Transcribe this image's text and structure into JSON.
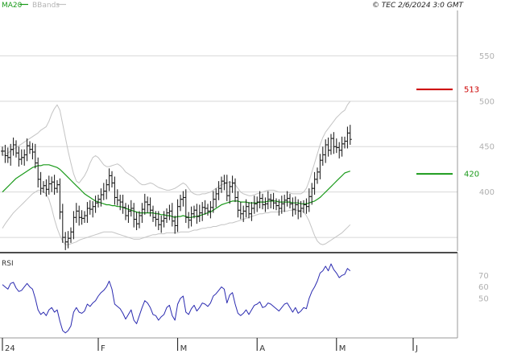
{
  "legend": {
    "ma_label": "MA20",
    "bb_label": "BBands"
  },
  "copyright": "© TEC 2/6/2024 3:0 GMT",
  "colors": {
    "price": "#111111",
    "ma": "#1a9a1a",
    "bbands": "#c4c4c4",
    "resistance": "#cc0000",
    "support": "#1a9a1a",
    "rsi": "#2a2ab0",
    "grid": "#d8d8d8"
  },
  "chart_data": [
    {
      "type": "ohlc",
      "yticks": [
        550,
        500,
        450,
        400
      ],
      "ylim": [
        335,
        600
      ],
      "x_ticks": [
        {
          "label": "24",
          "bar": 0
        },
        {
          "label": "F",
          "bar": 35
        },
        {
          "label": "M",
          "bar": 64
        },
        {
          "label": "A",
          "bar": 93
        },
        {
          "label": "M",
          "bar": 122
        },
        {
          "label": "J",
          "bar": 150
        }
      ],
      "levels": [
        {
          "value": 513,
          "label": "513",
          "kind": "resistance"
        },
        {
          "value": 420,
          "label": "420",
          "kind": "support"
        }
      ],
      "close": [
        445,
        440,
        438,
        447,
        452,
        443,
        436,
        438,
        441,
        451,
        447,
        444,
        432,
        414,
        404,
        407,
        403,
        409,
        411,
        404,
        408,
        378,
        350,
        345,
        349,
        356,
        372,
        379,
        372,
        371,
        374,
        382,
        381,
        384,
        388,
        392,
        397,
        401,
        408,
        418,
        410,
        394,
        391,
        389,
        383,
        374,
        379,
        382,
        370,
        365,
        374,
        381,
        389,
        386,
        380,
        372,
        370,
        364,
        368,
        371,
        377,
        379,
        368,
        363,
        384,
        392,
        394,
        372,
        369,
        376,
        380,
        373,
        377,
        383,
        382,
        379,
        383,
        392,
        398,
        404,
        412,
        410,
        396,
        406,
        410,
        394,
        380,
        376,
        379,
        384,
        376,
        382,
        387,
        389,
        393,
        386,
        387,
        392,
        391,
        388,
        385,
        382,
        387,
        391,
        393,
        387,
        381,
        386,
        379,
        382,
        386,
        384,
        395,
        404,
        414,
        422,
        435,
        441,
        452,
        446,
        459,
        450,
        449,
        446,
        453,
        456,
        465,
        458
      ],
      "ma20": [
        400,
        403,
        406,
        409,
        412,
        415,
        417,
        419,
        421,
        423,
        425,
        427,
        428,
        429,
        429,
        430,
        430,
        430,
        429,
        428,
        427,
        425,
        422,
        419,
        416,
        413,
        410,
        407,
        404,
        401,
        398,
        396,
        394,
        392,
        390,
        389,
        388,
        387,
        386,
        386,
        385,
        385,
        384,
        384,
        383,
        382,
        381,
        380,
        379,
        378,
        377,
        377,
        377,
        377,
        377,
        377,
        376,
        376,
        375,
        375,
        374,
        374,
        373,
        372,
        373,
        373,
        374,
        373,
        372,
        372,
        373,
        373,
        374,
        375,
        376,
        377,
        378,
        380,
        382,
        384,
        386,
        387,
        388,
        389,
        390,
        390,
        390,
        389,
        389,
        389,
        388,
        388,
        388,
        388,
        389,
        389,
        389,
        390,
        390,
        390,
        390,
        389,
        389,
        389,
        389,
        389,
        388,
        388,
        388,
        387,
        387,
        387,
        388,
        389,
        390,
        392,
        394,
        397,
        400,
        403,
        406,
        409,
        412,
        415,
        418,
        421,
        422,
        423
      ],
      "bb_upper": [
        440,
        441,
        443,
        445,
        447,
        449,
        451,
        453,
        455,
        457,
        459,
        461,
        463,
        465,
        468,
        470,
        472,
        478,
        486,
        492,
        496,
        490,
        475,
        460,
        445,
        432,
        420,
        412,
        410,
        414,
        418,
        424,
        432,
        438,
        440,
        438,
        434,
        430,
        428,
        428,
        429,
        430,
        431,
        429,
        426,
        422,
        420,
        418,
        416,
        413,
        410,
        408,
        408,
        409,
        410,
        409,
        407,
        405,
        404,
        403,
        402,
        402,
        403,
        404,
        406,
        408,
        410,
        408,
        404,
        400,
        398,
        397,
        397,
        398,
        398,
        399,
        400,
        402,
        404,
        406,
        408,
        409,
        410,
        411,
        410,
        408,
        404,
        400,
        398,
        397,
        396,
        396,
        397,
        398,
        399,
        400,
        401,
        402,
        402,
        402,
        401,
        400,
        400,
        400,
        400,
        399,
        398,
        398,
        398,
        398,
        400,
        404,
        412,
        422,
        432,
        442,
        452,
        460,
        466,
        470,
        474,
        478,
        482,
        485,
        488,
        490,
        496,
        500
      ],
      "bb_lower": [
        360,
        365,
        369,
        373,
        377,
        380,
        383,
        386,
        389,
        392,
        395,
        398,
        400,
        402,
        402,
        400,
        398,
        392,
        382,
        370,
        360,
        352,
        346,
        342,
        342,
        343,
        344,
        345,
        347,
        348,
        349,
        350,
        351,
        352,
        353,
        354,
        355,
        356,
        356,
        356,
        356,
        355,
        354,
        353,
        352,
        351,
        350,
        349,
        348,
        348,
        348,
        349,
        350,
        351,
        352,
        353,
        353,
        354,
        354,
        354,
        355,
        355,
        355,
        355,
        355,
        356,
        356,
        356,
        356,
        357,
        358,
        358,
        359,
        360,
        360,
        361,
        361,
        362,
        362,
        363,
        364,
        364,
        365,
        366,
        366,
        367,
        368,
        369,
        370,
        371,
        372,
        373,
        374,
        375,
        376,
        376,
        377,
        377,
        378,
        378,
        378,
        378,
        379,
        379,
        379,
        380,
        380,
        380,
        380,
        380,
        378,
        374,
        368,
        360,
        352,
        346,
        343,
        342,
        343,
        345,
        347,
        349,
        351,
        353,
        355,
        358,
        361,
        364
      ]
    },
    {
      "type": "line",
      "name": "RSI",
      "yticks": [
        70,
        60,
        50
      ],
      "ylim": [
        17,
        87
      ],
      "values": [
        62,
        60,
        58,
        63,
        64,
        59,
        56,
        57,
        60,
        63,
        60,
        58,
        50,
        40,
        36,
        38,
        35,
        40,
        42,
        38,
        40,
        30,
        22,
        20,
        22,
        26,
        38,
        42,
        38,
        37,
        39,
        45,
        43,
        46,
        48,
        52,
        55,
        57,
        60,
        65,
        58,
        45,
        43,
        41,
        37,
        32,
        36,
        40,
        31,
        28,
        35,
        42,
        48,
        46,
        42,
        36,
        35,
        31,
        34,
        36,
        42,
        44,
        35,
        31,
        45,
        50,
        52,
        38,
        36,
        41,
        44,
        39,
        42,
        46,
        45,
        43,
        46,
        52,
        54,
        57,
        60,
        58,
        46,
        53,
        55,
        45,
        37,
        35,
        37,
        40,
        36,
        40,
        44,
        45,
        47,
        42,
        43,
        46,
        45,
        43,
        41,
        39,
        42,
        45,
        46,
        42,
        38,
        42,
        37,
        39,
        42,
        41,
        50,
        56,
        60,
        65,
        72,
        74,
        78,
        74,
        80,
        75,
        72,
        68,
        70,
        71,
        76,
        74
      ]
    }
  ]
}
